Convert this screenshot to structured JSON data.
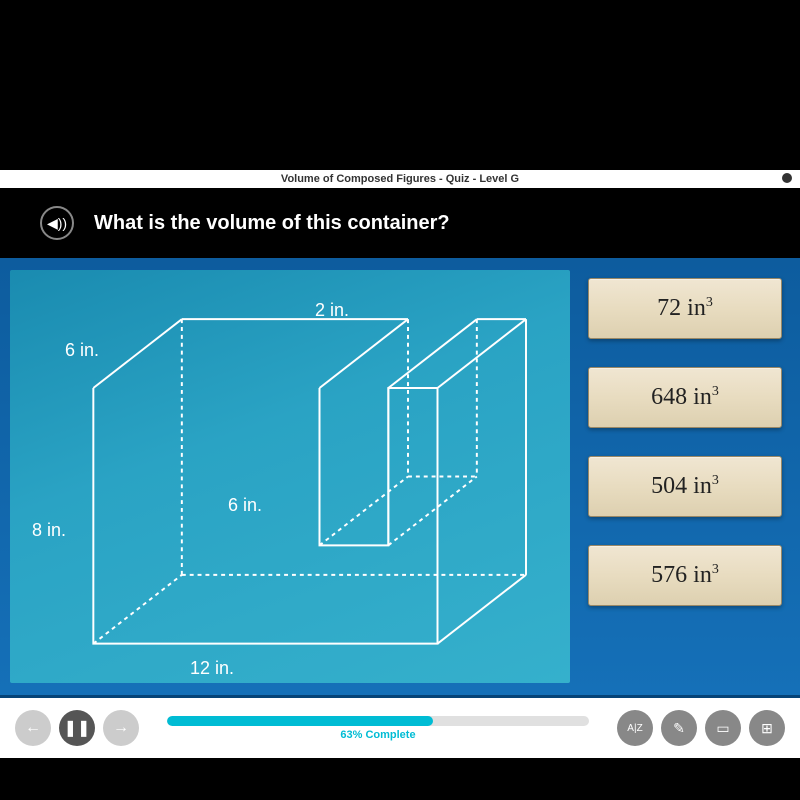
{
  "title_bar": "Volume of Composed Figures - Quiz - Level G",
  "question": "What is the volume of this container?",
  "figure": {
    "dimensions": {
      "top_depth": "6 in.",
      "top_cutout_width": "2 in.",
      "inner_height": "6 in.",
      "left_height": "8 in.",
      "bottom_width": "12 in."
    }
  },
  "answers": {
    "a": {
      "value": "72 in",
      "exp": "3"
    },
    "b": {
      "value": "648 in",
      "exp": "3"
    },
    "c": {
      "value": "504 in",
      "exp": "3"
    },
    "d": {
      "value": "576 in",
      "exp": "3"
    }
  },
  "progress": {
    "percent": 63,
    "label": "63% Complete"
  },
  "icons": {
    "audio": "◀))",
    "back": "←",
    "pause": "❚❚",
    "forward": "→",
    "az": "A|Z",
    "pencil": "✎",
    "note": "▭",
    "calc": "⊞"
  }
}
